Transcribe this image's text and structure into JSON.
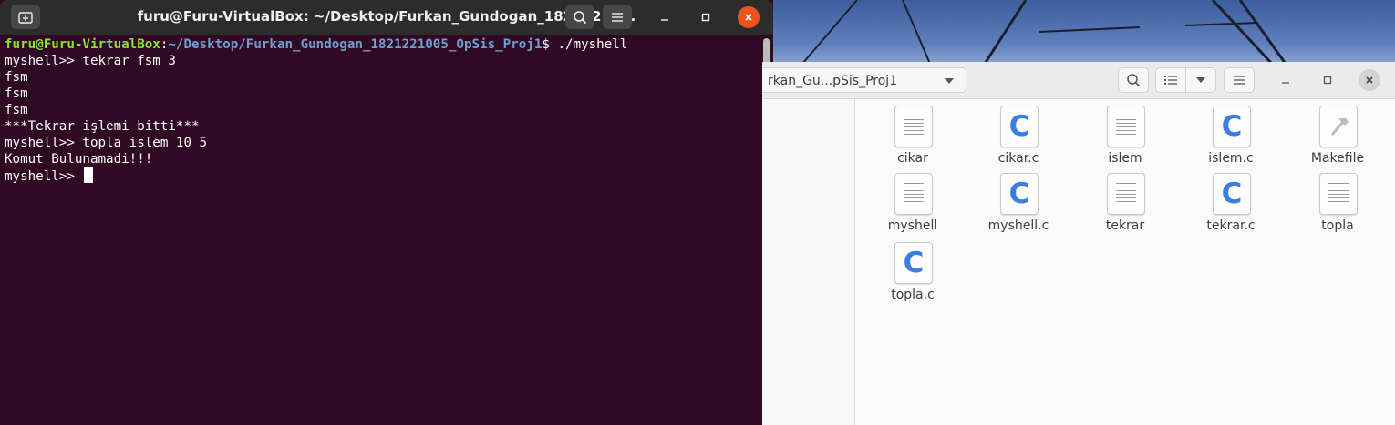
{
  "terminal": {
    "title": "furu@Furu-VirtualBox: ~/Desktop/Furkan_Gundogan_18212210...",
    "prompt": {
      "user_host": "furu@Furu-VirtualBox",
      "colon": ":",
      "path": "~/Desktop/Furkan_Gundogan_1821221005_OpSis_Proj1",
      "dollar": "$ ./myshell"
    },
    "lines": [
      "myshell>> tekrar fsm 3",
      "fsm",
      "fsm",
      "fsm",
      "***Tekrar işlemi bitti***",
      "myshell>> topla islem 10 5",
      "Komut Bulunamadi!!!",
      "myshell>> "
    ]
  },
  "files": {
    "path_label": "rkan_Gu...pSis_Proj1",
    "items": [
      {
        "name": "cikar",
        "type": "binary"
      },
      {
        "name": "cikar.c",
        "type": "c"
      },
      {
        "name": "islem",
        "type": "binary"
      },
      {
        "name": "islem.c",
        "type": "c"
      },
      {
        "name": "Makefile",
        "type": "makefile"
      },
      {
        "name": "myshell",
        "type": "binary"
      },
      {
        "name": "myshell.c",
        "type": "c"
      },
      {
        "name": "tekrar",
        "type": "binary"
      },
      {
        "name": "tekrar.c",
        "type": "c"
      },
      {
        "name": "topla",
        "type": "binary"
      },
      {
        "name": "topla.c",
        "type": "c"
      }
    ],
    "c_icon_letter": "C"
  },
  "colors": {
    "terminal_bg": "#300a24",
    "prompt_green": "#8ae234",
    "prompt_blue": "#729fcf",
    "close_orange": "#e95420"
  }
}
